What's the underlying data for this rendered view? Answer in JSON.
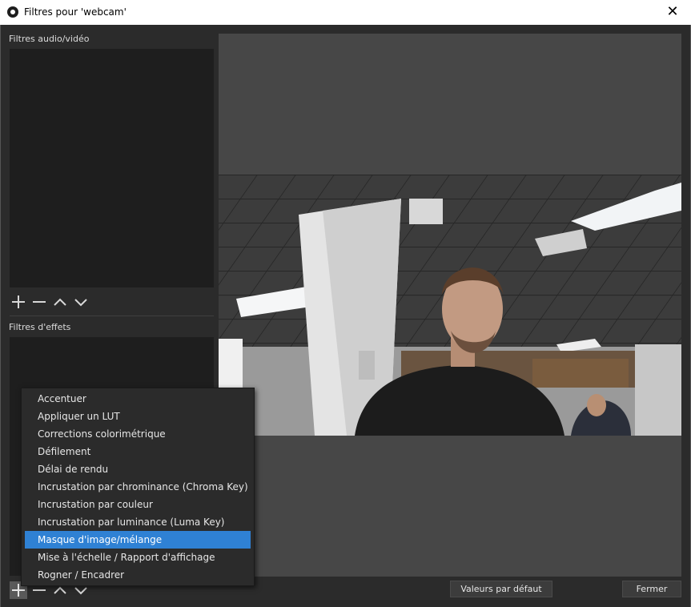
{
  "window": {
    "title": "Filtres pour 'webcam'"
  },
  "audio_video": {
    "label": "Filtres audio/vidéo"
  },
  "effects": {
    "label": "Filtres d'effets"
  },
  "buttons": {
    "defaults": "Valeurs par défaut",
    "close": "Fermer"
  },
  "menu": {
    "items": [
      "Accentuer",
      "Appliquer un LUT",
      "Corrections colorimétrique",
      "Défilement",
      "Délai de rendu",
      "Incrustation par chrominance (Chroma Key)",
      "Incrustation par couleur",
      "Incrustation par luminance (Luma Key)",
      "Masque d'image/mélange",
      "Mise à l'échelle / Rapport d'affichage",
      "Rogner / Encadrer"
    ],
    "selected_index": 8
  },
  "colors": {
    "accent": "#2f81d4",
    "background": "#2b2b2b",
    "list": "#1e1e1e",
    "preview": "#474747"
  }
}
